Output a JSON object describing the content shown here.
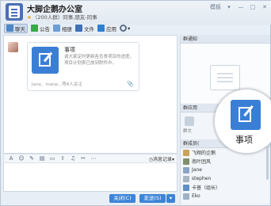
{
  "window": {
    "title": "大脚企鹅办公室",
    "member_count": "（200人群）",
    "subtitle": "同事,朋友-同事",
    "controls": {
      "mode": "模板",
      "dropdown": "▾",
      "minimize": "—",
      "maximize": "□",
      "close": "✕"
    }
  },
  "toolbar": {
    "items": [
      {
        "label": "聊天",
        "icon": "chat-icon"
      },
      {
        "label": "公告",
        "icon": "notice-icon"
      },
      {
        "label": "相册",
        "icon": "photo-icon"
      },
      {
        "label": "文件",
        "icon": "file-icon"
      },
      {
        "label": "应用",
        "icon": "app-icon"
      }
    ],
    "settings_icon": "gear-icon",
    "settings_dropdown": "▾"
  },
  "message": {
    "card_title": "事项",
    "card_desc": "请大家定时更新各负责项目的进度，项目计划表已放到附件中。",
    "card_footer": "Jane、manp...等8人关注",
    "clip": "📎"
  },
  "formatbar": {
    "items": [
      "A",
      "☺",
      "✎",
      "▤",
      "▭",
      "⇧",
      "♫",
      "✂",
      "⋯"
    ],
    "history_label": "◷消息记录▾"
  },
  "buttons": {
    "close": "关闭(C)",
    "send": "发送(S)",
    "dropdown": "▾"
  },
  "right_panel": {
    "notice_head": "群通知",
    "files_head": "群应用",
    "files_label": "群文",
    "members_head": "群成员(",
    "members": [
      {
        "name": "飞翔的企鹅"
      },
      {
        "name": "南叶团风"
      },
      {
        "name": "Jane"
      },
      {
        "name": "stephen"
      },
      {
        "name": "卡普（组长）"
      },
      {
        "name": "Eko"
      }
    ]
  },
  "callout": {
    "label": "事项"
  },
  "colors": {
    "accent": "#3a7fd5",
    "button": "#3b84d8",
    "star": "#e8a11a"
  }
}
